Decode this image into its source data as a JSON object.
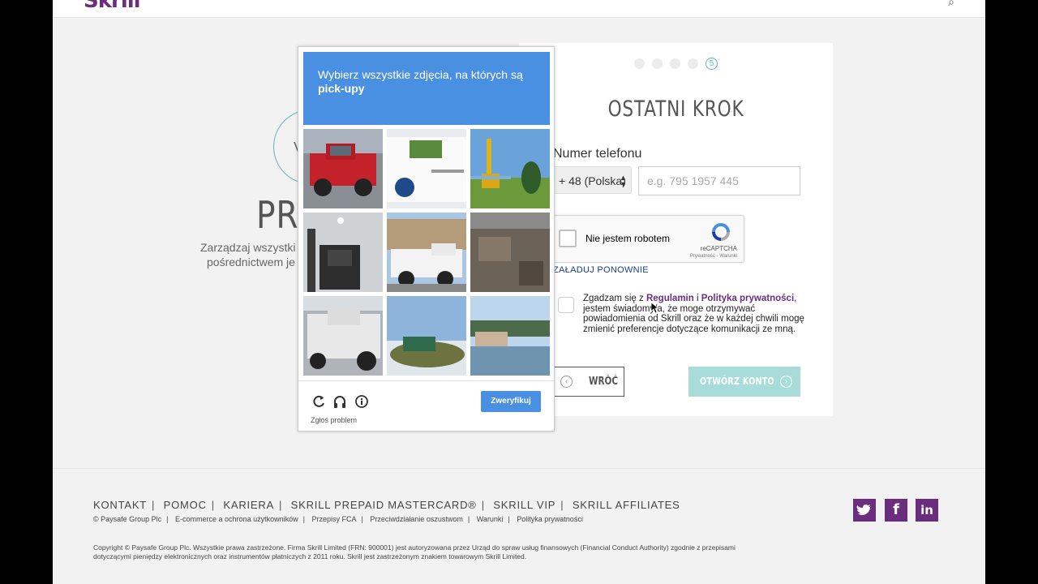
{
  "header": {
    "logo": "Skrill"
  },
  "hero": {
    "title": "PR",
    "icon_letter": "V",
    "subtitle_line1": "Zarządzaj wszystki",
    "subtitle_line2": "pośrednictwem je"
  },
  "signup": {
    "steps": [
      "",
      "",
      "",
      "",
      "5"
    ],
    "title": "OSTATNI KROK",
    "phone_label": "Numer telefonu",
    "country_value": "+ 48 (Polska)",
    "phone_placeholder": "e.g. 795 1957 445",
    "recaptcha": {
      "label": "Nie jestem robotem",
      "brand": "reCAPTCHA",
      "links": "Prywatność - Warunki"
    },
    "reload_link": "ZAŁADUJ PONOWNIE",
    "terms": {
      "prefix": "Zgadzam się z ",
      "regulamin": "Regulamin",
      "and": " i ",
      "privacy": "Polityka prywatności",
      "suffix": ", jestem świadomy/a, że moge otrzymywać powiadomienia od Skrill oraz że w każdej chwili mogę zmienić preferencje dotyczące komunikacji ze mną."
    },
    "back_label": "WRÓĆ",
    "open_label": "OTWÓRZ KONTO",
    "accent_color": "#5ab7b3"
  },
  "challenge": {
    "instruction": "Wybierz wszystkie zdjęcia, na których są",
    "target": "pick-upy",
    "verify_label": "Zweryfikuj",
    "report_label": "Zgłoś problem",
    "header_color": "#4a90e2"
  },
  "footer": {
    "nav": [
      "KONTAKT",
      "POMOC",
      "KARIERA",
      "SKRILL PREPAID MASTERCARD®",
      "SKRILL VIP",
      "SKRILL AFFILIATES"
    ],
    "links": [
      "© Paysafe Group Plc",
      "E-commerce a ochrona użytkowników",
      "Przepisy FCA",
      "Przeciwdziałanie oszustwom",
      "Warunki",
      "Polityka prywatności"
    ],
    "copyright": "Copyright © Paysafe Group Plc. Wszystkie prawa zastrzeżone. Firma Skrill Limited (FRN: 900001) jest autoryzowana przez Urząd do spraw usług finansowych (Financial Conduct Authority) zgodnie z przepisami dotyczącymi pieniędzy elektronicznych oraz instrumentów płatniczych z 2011 roku. Skrill jest zastrzeżonym znakiem towarowym Skrill Limited.",
    "social": [
      "twitter-icon",
      "facebook-icon",
      "linkedin-icon"
    ],
    "brand_color": "#6b2d7e"
  }
}
